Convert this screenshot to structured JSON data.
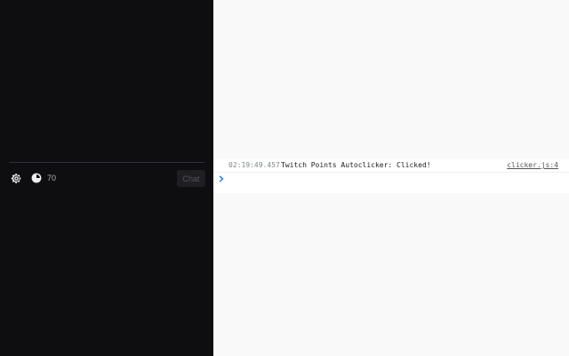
{
  "chat": {
    "points_value": "70",
    "chat_button_label": "Chat",
    "icons": {
      "settings": "gear-icon",
      "points": "channel-points-icon"
    },
    "colors": {
      "background": "#0e0e10",
      "divider": "#2e2d45",
      "points_text": "#adadb8"
    }
  },
  "console": {
    "log": {
      "timestamp": "02:19:49.457",
      "message": "Twitch Points Autoclicker: Clicked!",
      "source": "clicker.js:4"
    },
    "prompt": {
      "icon": "chevron-right-icon",
      "value": ""
    },
    "colors": {
      "prompt_accent": "#1a73e8"
    }
  }
}
